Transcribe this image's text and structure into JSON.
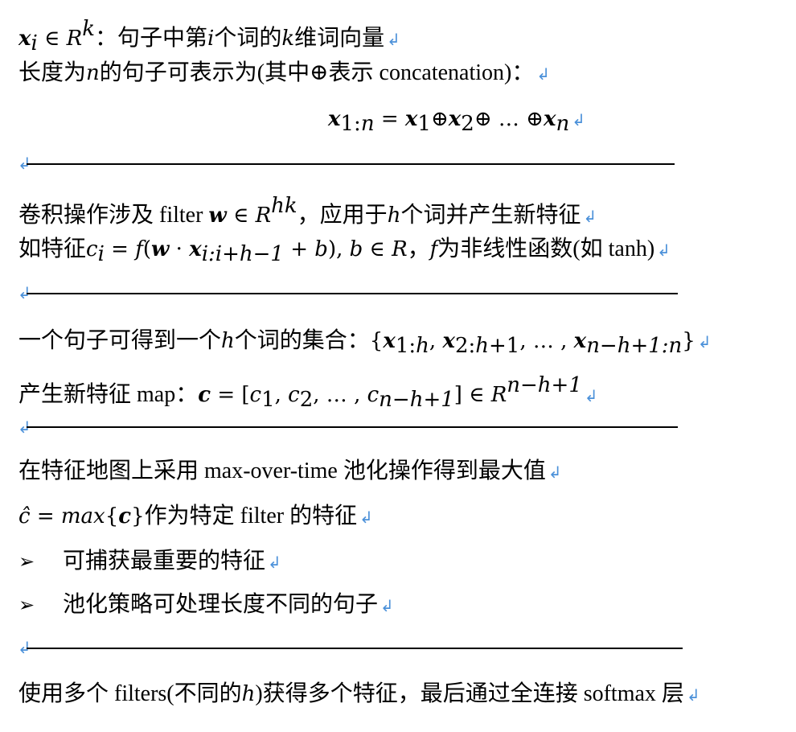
{
  "return_mark": "↲",
  "bullet_glyph": "➢",
  "section1": {
    "def_text": "：句子中第",
    "def_text2": "个词的",
    "def_text3": "维词向量",
    "length_prefix": "长度为",
    "length_text": "的句子可表示为(其中⊕表示 concatenation)："
  },
  "section2": {
    "conv_text": "卷积操作涉及 filter ",
    "conv_text2": "，应用于",
    "conv_text3": "个词并产生新特征",
    "feature_prefix": "如特征",
    "feature_text": "，",
    "feature_text2": "为非线性函数(如 tanh)"
  },
  "section3": {
    "set_text": "一个句子可得到一个",
    "set_text2": "个词的集合：",
    "map_text": "产生新特征 map："
  },
  "section4": {
    "pool_text": "在特征地图上采用 max-over-time 池化操作得到最大值",
    "chat_text": "作为特定 filter 的特征",
    "bullets": [
      "可捕获最重要的特征",
      "池化策略可处理长度不同的句子"
    ]
  },
  "section5": {
    "final_text1": "使用多个 filters(不同的",
    "final_text2": ")获得多个特征，最后通过全连接 softmax 层"
  }
}
